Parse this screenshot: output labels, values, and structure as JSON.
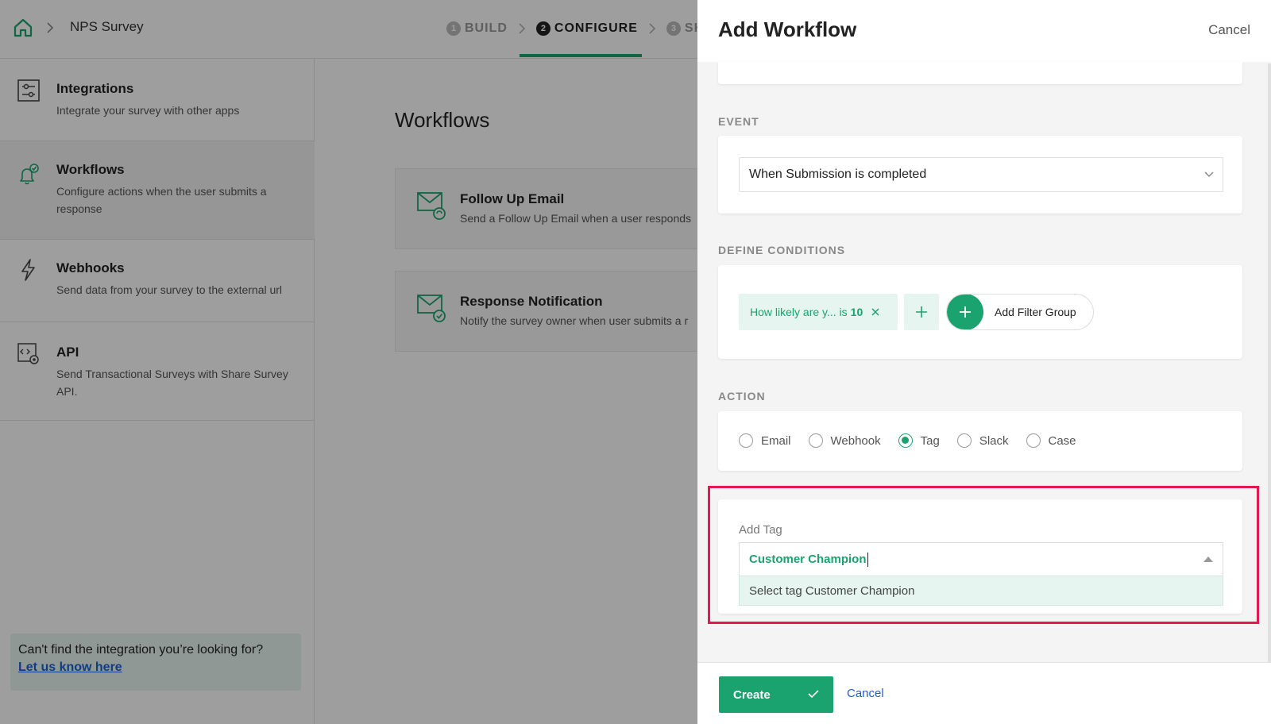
{
  "topbar": {
    "home_icon": "home-icon",
    "breadcrumb": "NPS Survey",
    "steps": [
      {
        "num": "1",
        "label": "BUILD"
      },
      {
        "num": "2",
        "label": "CONFIGURE"
      },
      {
        "num": "3",
        "label": "SHA"
      }
    ]
  },
  "sidebar": {
    "items": [
      {
        "title": "Integrations",
        "desc": "Integrate your survey with other apps",
        "icon": "sliders-icon"
      },
      {
        "title": "Workflows",
        "desc": "Configure actions when the user submits a response",
        "icon": "bell-check-icon"
      },
      {
        "title": "Webhooks",
        "desc": "Send data from your survey to the external url",
        "icon": "lightning-icon"
      },
      {
        "title": "API",
        "desc": "Send Transactional Surveys with Share Survey API.",
        "icon": "api-gear-icon"
      }
    ],
    "help_text": "Can't find the integration you’re looking for?",
    "help_link": "Let us know here"
  },
  "main": {
    "title": "Workflows",
    "cards": [
      {
        "title": "Follow Up Email",
        "desc": "Send a Follow Up Email when a user responds",
        "icon": "email-refresh-icon"
      },
      {
        "title": "Response Notification",
        "desc": "Notify the survey owner when user submits a r",
        "icon": "email-check-icon"
      }
    ]
  },
  "drawer": {
    "title": "Add Workflow",
    "cancel": "Cancel",
    "event_label": "EVENT",
    "event_value": "When Submission is completed",
    "conditions_label": "DEFINE CONDITIONS",
    "condition_chip_text": "How likely are y... is",
    "condition_chip_value": "10",
    "add_filter_group": "Add Filter Group",
    "action_label": "ACTION",
    "actions": [
      {
        "label": "Email",
        "checked": false
      },
      {
        "label": "Webhook",
        "checked": false
      },
      {
        "label": "Tag",
        "checked": true
      },
      {
        "label": "Slack",
        "checked": false
      },
      {
        "label": "Case",
        "checked": false
      }
    ],
    "add_tag_label": "Add Tag",
    "tag_input_value": "Customer Champion",
    "tag_option": "Select tag Customer Champion",
    "create": "Create",
    "footer_cancel": "Cancel"
  },
  "colors": {
    "accent": "#1aa36f",
    "highlight": "#e5194f",
    "link": "#1d5fd0"
  }
}
